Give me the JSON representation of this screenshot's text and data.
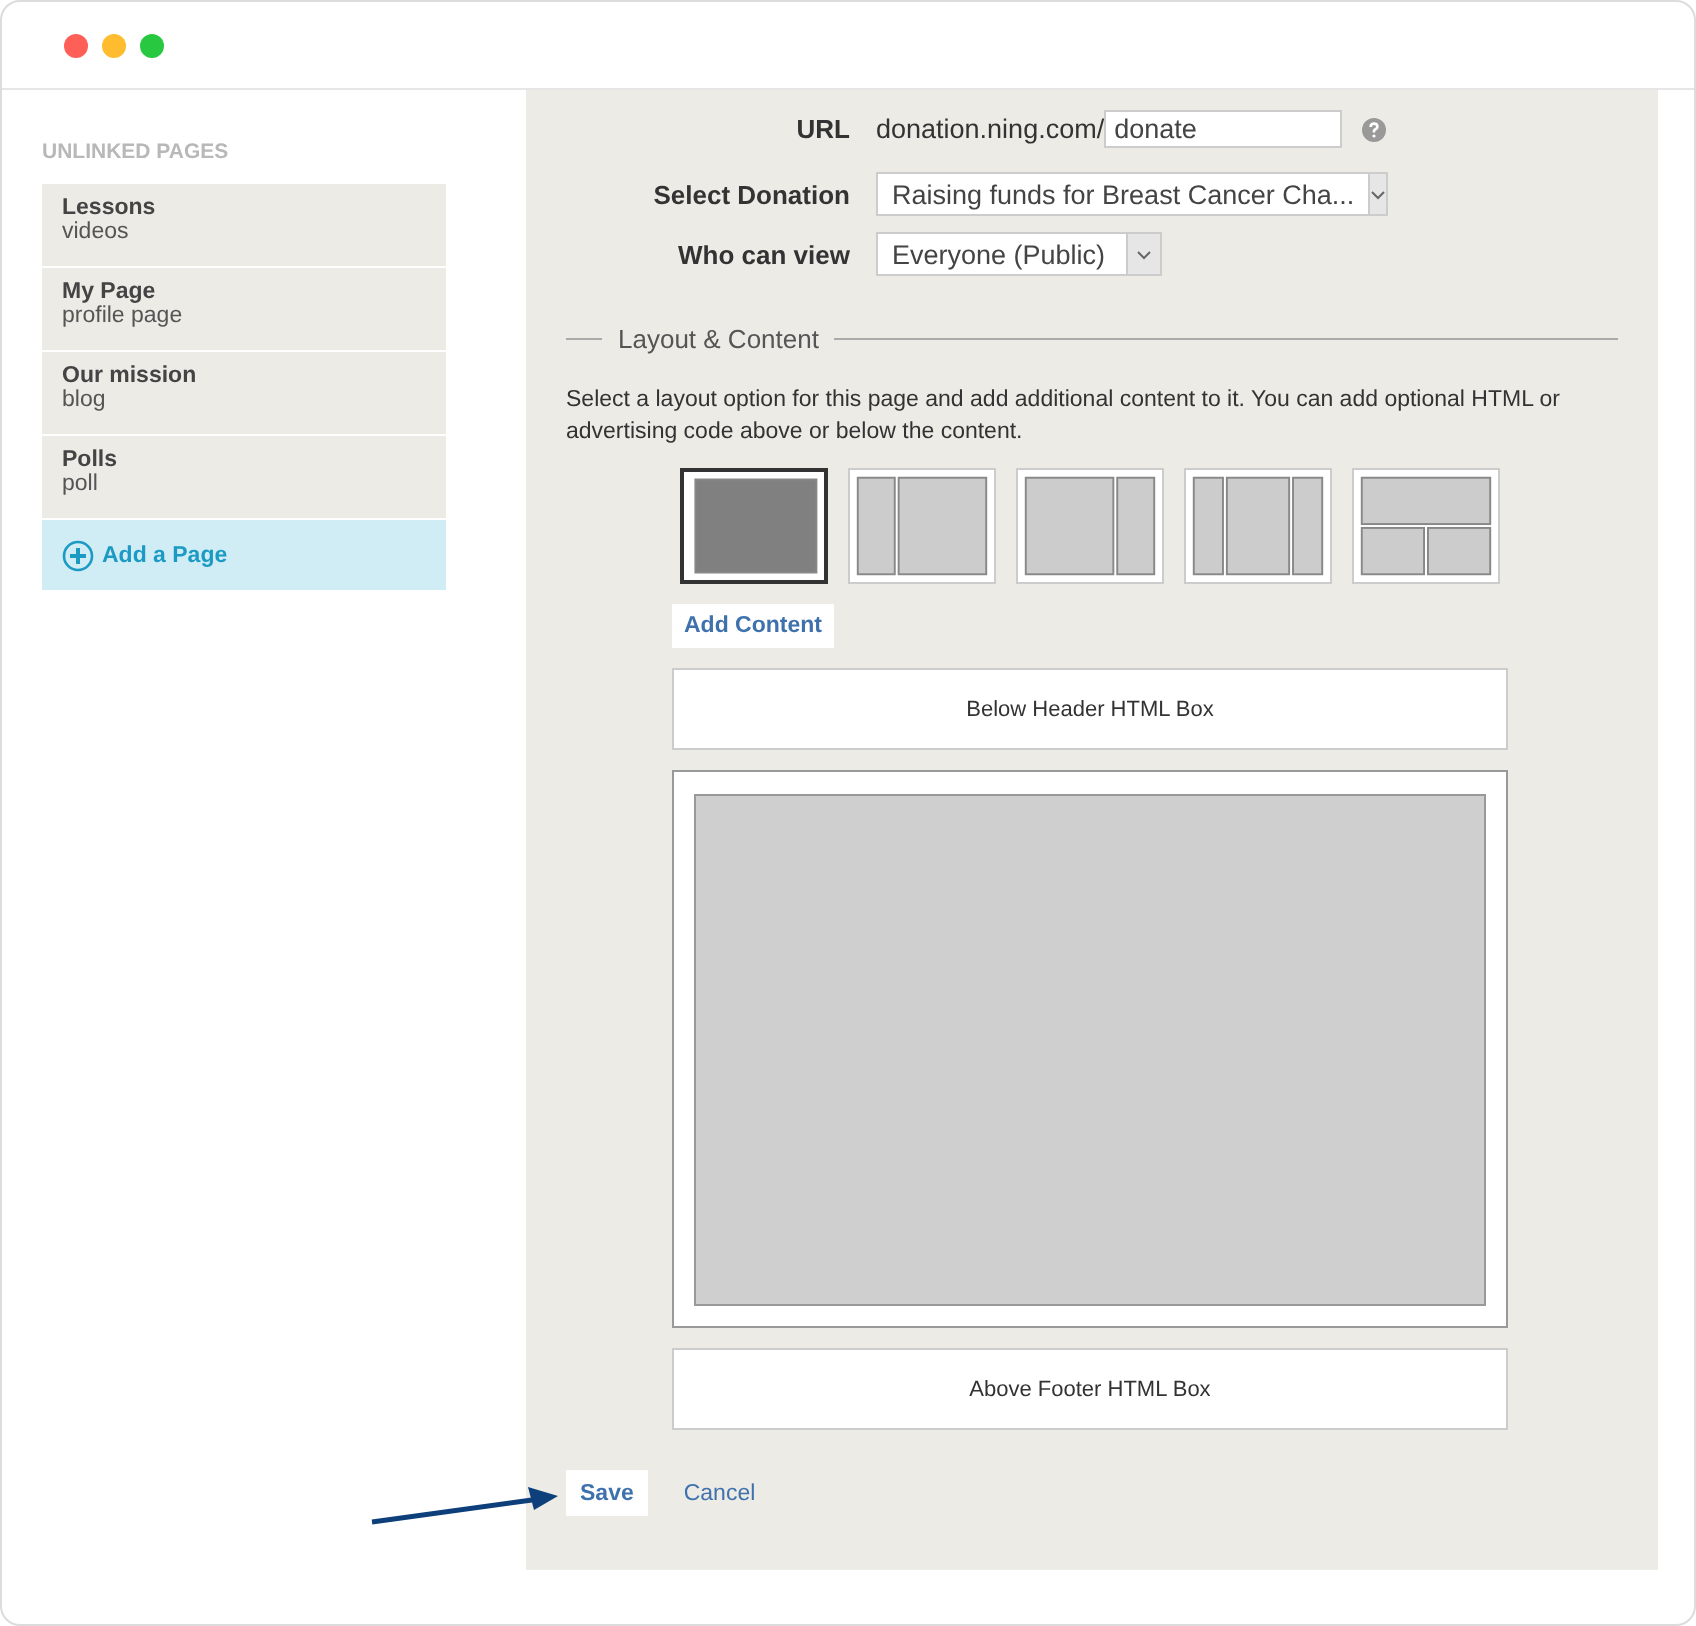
{
  "sidebar": {
    "heading": "UNLINKED PAGES",
    "items": [
      {
        "title": "Lessons",
        "subtitle": "videos"
      },
      {
        "title": "My Page",
        "subtitle": "profile page"
      },
      {
        "title": "Our mission",
        "subtitle": "blog"
      },
      {
        "title": "Polls",
        "subtitle": "poll"
      }
    ],
    "add_button": "Add a Page"
  },
  "form": {
    "url_label": "URL",
    "url_prefix": "donation.ning.com/",
    "url_value": "donate",
    "donation_label": "Select Donation",
    "donation_value": "Raising funds for Breast Cancer Cha...",
    "view_label": "Who can view",
    "view_value": "Everyone (Public)"
  },
  "layout_section": {
    "title": "Layout & Content",
    "description": "Select a layout option for this page and add additional content to it. You can add optional HTML or advertising code above or below the content.",
    "layouts": [
      {
        "kind": "full",
        "selected": true
      },
      {
        "kind": "left-sidebar",
        "selected": false
      },
      {
        "kind": "right-sidebar",
        "selected": false
      },
      {
        "kind": "three-column",
        "selected": false
      },
      {
        "kind": "top-split",
        "selected": false
      }
    ],
    "add_content": "Add Content",
    "header_box": "Below Header HTML Box",
    "footer_box": "Above Footer HTML Box"
  },
  "actions": {
    "save": "Save",
    "cancel": "Cancel"
  }
}
